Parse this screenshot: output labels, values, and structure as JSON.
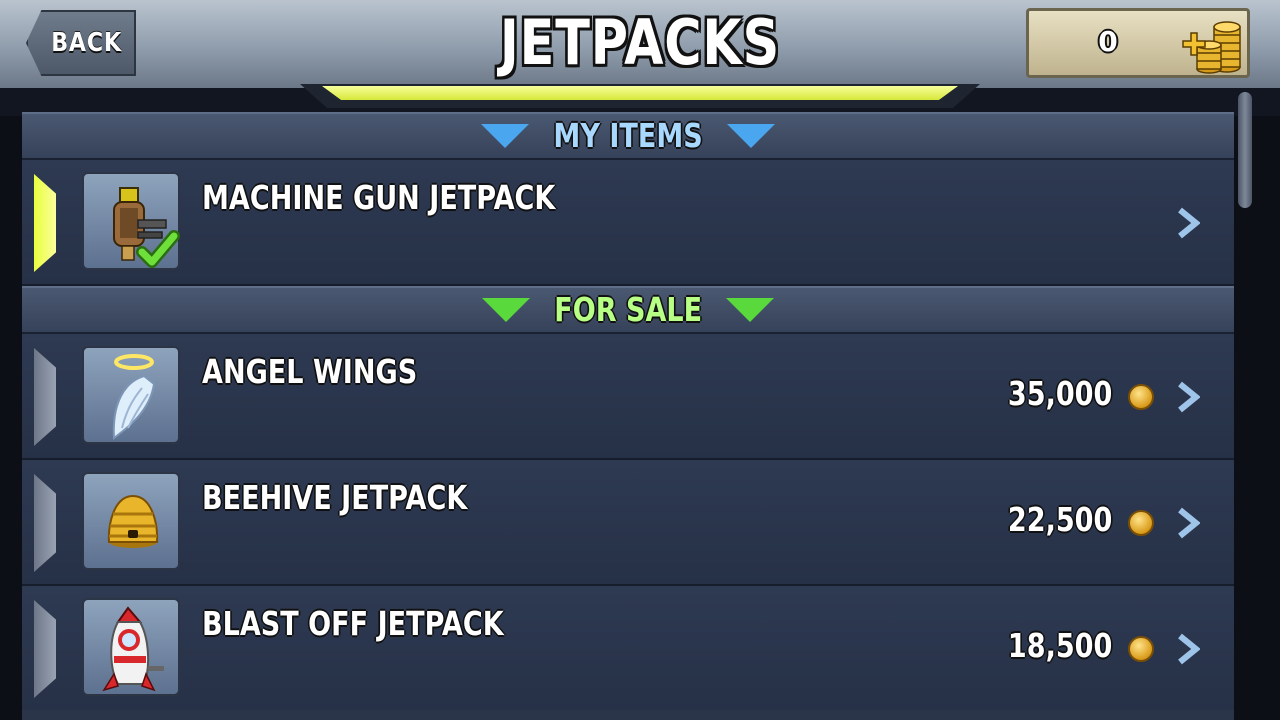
{
  "header": {
    "back_label": "BACK",
    "title": "JETPACKS",
    "coins": "0",
    "coin_icon": "coin-stack-plus-icon"
  },
  "sections": {
    "my_items": {
      "label": "MY ITEMS",
      "color": "#a9d8ff",
      "arrow_color": "#4aa6ef"
    },
    "for_sale": {
      "label": "FOR SALE",
      "color": "#b8ff86",
      "arrow_color": "#59d93c"
    }
  },
  "owned_items": [
    {
      "name": "MACHINE GUN JETPACK",
      "icon": "machine-gun-jetpack-icon",
      "equipped": true
    }
  ],
  "sale_items": [
    {
      "name": "ANGEL WINGS",
      "price": "35,000",
      "icon": "angel-wings-icon"
    },
    {
      "name": "BEEHIVE JETPACK",
      "price": "22,500",
      "icon": "beehive-jetpack-icon"
    },
    {
      "name": "BLAST OFF JETPACK",
      "price": "18,500",
      "icon": "blast-off-jetpack-icon"
    }
  ],
  "colors": {
    "selected_marker": "#e9ff3d",
    "row_bg": "#2e3a52",
    "title_bar_glow": "#e6f56a"
  }
}
